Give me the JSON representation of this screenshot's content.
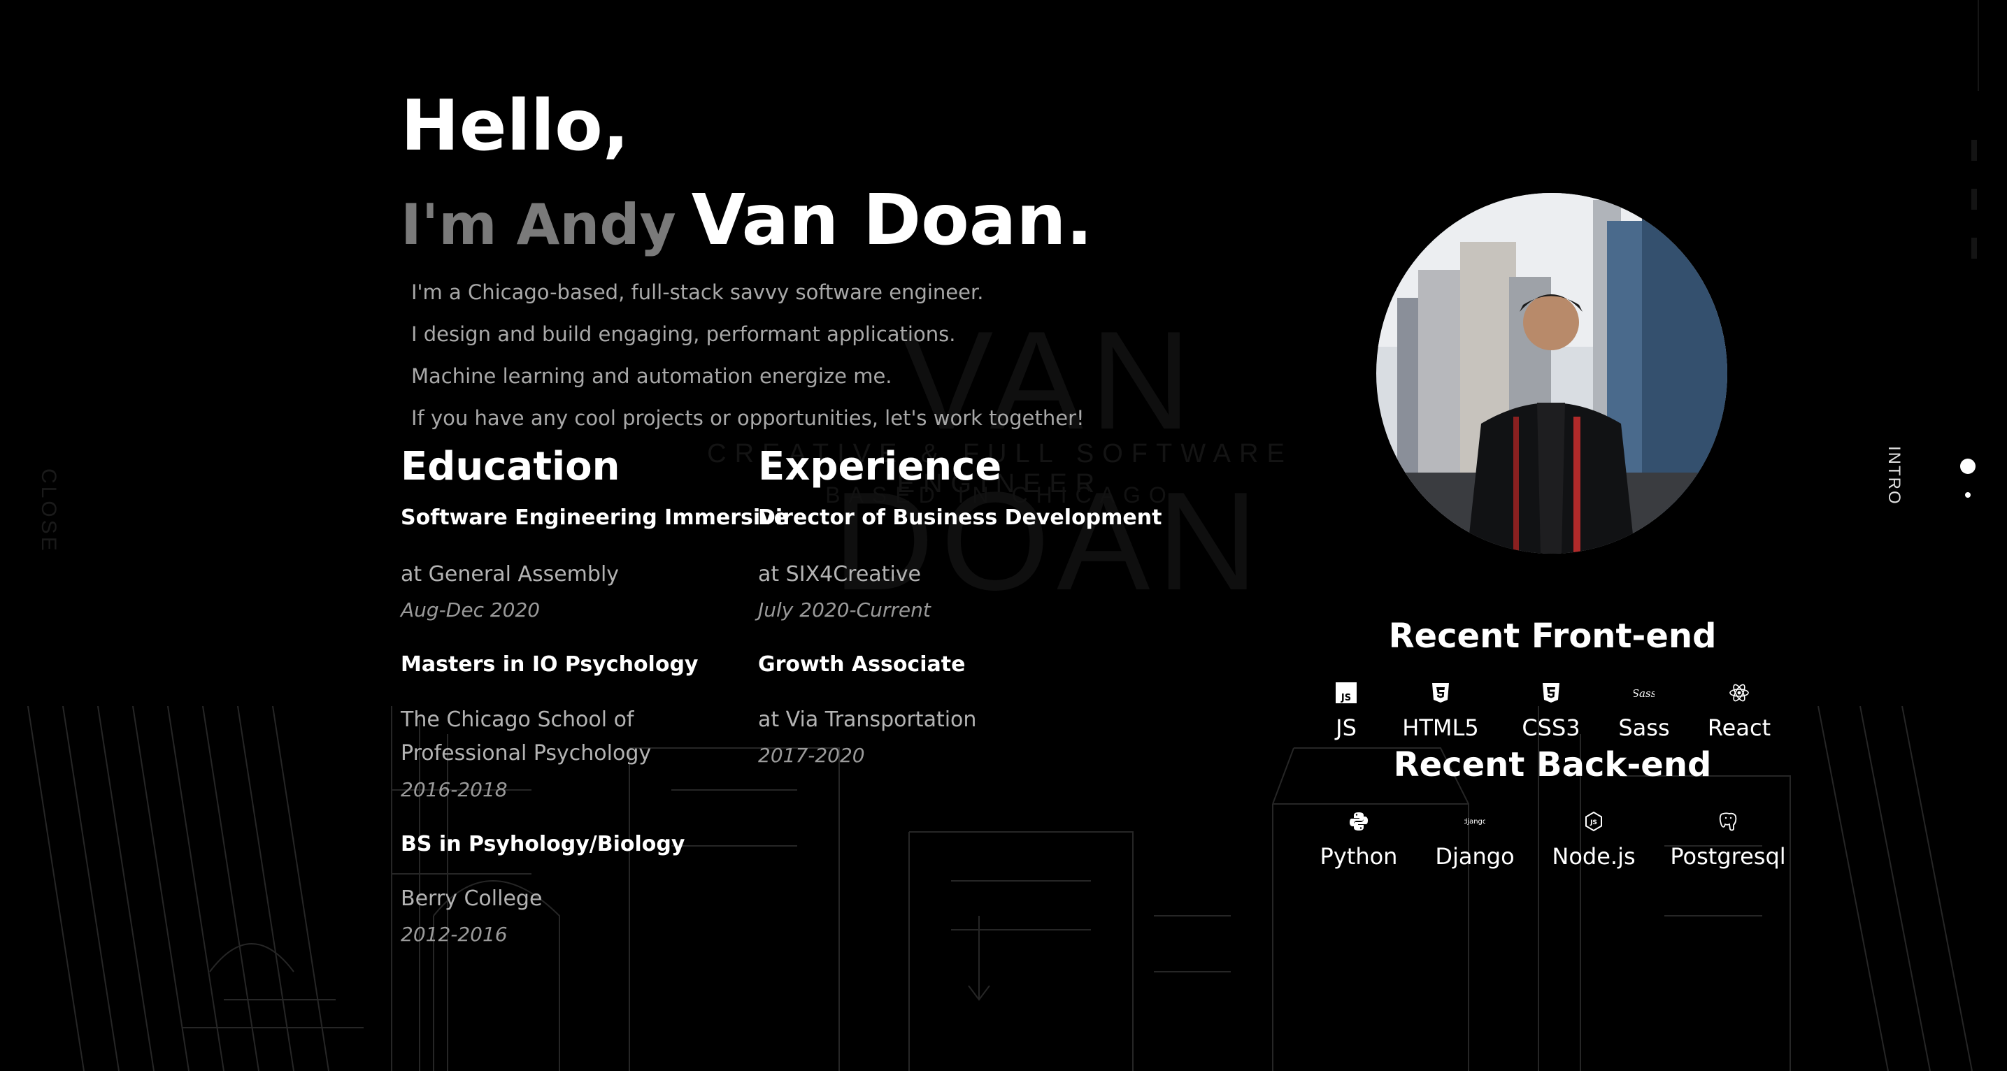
{
  "hero": {
    "greeting": "Hello,",
    "intro_prefix": "I'm Andy",
    "name": "Van Doan."
  },
  "bio": [
    "I'm a Chicago-based, full-stack savvy software engineer.",
    "I design and build engaging, performant applications.",
    "Machine learning and automation energize me.",
    "If you have any cool projects or opportunities, let's work together!"
  ],
  "education": {
    "title": "Education",
    "entries": [
      {
        "role": "Software Engineering Immersive",
        "org": "at General Assembly",
        "date": "Aug-Dec 2020"
      },
      {
        "role": "Masters in IO Psychology",
        "org": "The Chicago School of Professional Psychology",
        "date": "2016-2018"
      },
      {
        "role": "BS in Psyhology/Biology",
        "org": "Berry College",
        "date": "2012-2016"
      }
    ]
  },
  "experience": {
    "title": "Experience",
    "entries": [
      {
        "role": "Director of Business Development",
        "org": "at SIX4Creative",
        "date": "July 2020-Current"
      },
      {
        "role": "Growth Associate",
        "org": "at Via Transportation",
        "date": "2017-2020"
      }
    ]
  },
  "frontend": {
    "title": "Recent Front-end",
    "skills": [
      {
        "label": "JS",
        "icon": "js-icon"
      },
      {
        "label": "HTML5",
        "icon": "html5-icon"
      },
      {
        "label": "CSS3",
        "icon": "css3-icon"
      },
      {
        "label": "Sass",
        "icon": "sass-icon"
      },
      {
        "label": "React",
        "icon": "react-icon"
      }
    ]
  },
  "backend": {
    "title": "Recent Back-end",
    "skills": [
      {
        "label": "Python",
        "icon": "python-icon"
      },
      {
        "label": "Django",
        "icon": "django-icon"
      },
      {
        "label": "Node.js",
        "icon": "nodejs-icon"
      },
      {
        "label": "Postgresql",
        "icon": "postgresql-icon"
      }
    ]
  },
  "background": {
    "name": "VAN DOAN",
    "subtitle": "CREATIVE & FULL SOFTWARE ENGINEER",
    "location": "BASED IN CHICAGO",
    "side_label": "CLOSE"
  },
  "dot_nav": {
    "label": "INTRO"
  },
  "colors": {
    "background": "#000000",
    "text": "#ffffff",
    "muted": "#7a7a7a",
    "body_text": "#a8a8a8"
  }
}
